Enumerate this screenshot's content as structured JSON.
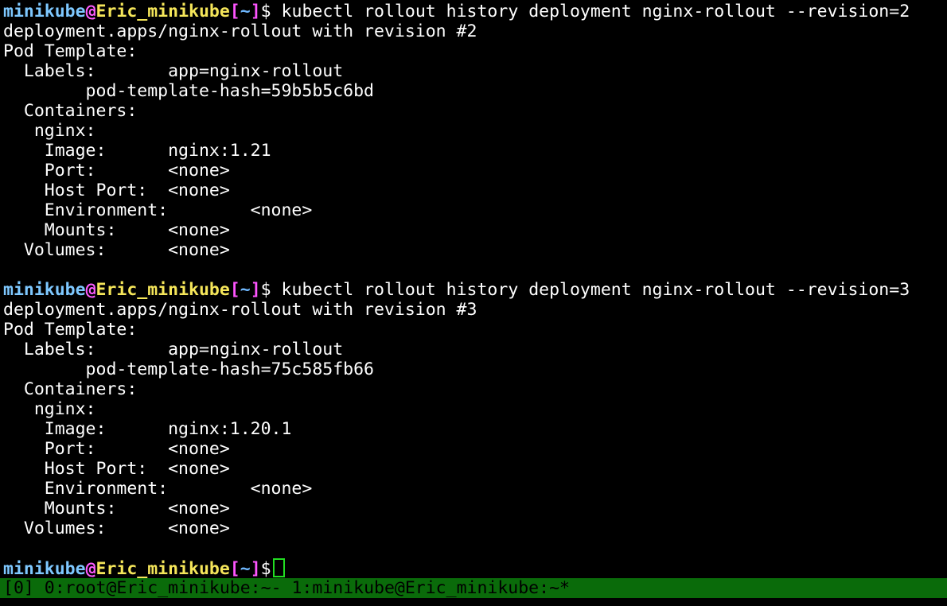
{
  "prompt": {
    "user": "minikube",
    "at": "@",
    "host": "Eric_minikube",
    "open_bracket": "[",
    "path": "~",
    "close_bracket": "]",
    "dollar": "$"
  },
  "blocks": [
    {
      "command": " kubectl rollout history deployment nginx-rollout --revision=2",
      "output": [
        "deployment.apps/nginx-rollout with revision #2",
        "Pod Template:",
        "  Labels:       app=nginx-rollout",
        "        pod-template-hash=59b5b5c6bd",
        "  Containers:",
        "   nginx:",
        "    Image:      nginx:1.21",
        "    Port:       <none>",
        "    Host Port:  <none>",
        "    Environment:        <none>",
        "    Mounts:     <none>",
        "  Volumes:      <none>",
        ""
      ]
    },
    {
      "command": " kubectl rollout history deployment nginx-rollout --revision=3",
      "output": [
        "deployment.apps/nginx-rollout with revision #3",
        "Pod Template:",
        "  Labels:       app=nginx-rollout",
        "        pod-template-hash=75c585fb66",
        "  Containers:",
        "   nginx:",
        "    Image:      nginx:1.20.1",
        "    Port:       <none>",
        "    Host Port:  <none>",
        "    Environment:        <none>",
        "    Mounts:     <none>",
        "  Volumes:      <none>",
        ""
      ]
    }
  ],
  "final_prompt_suffix": " ",
  "statusbar": {
    "session": "[0]",
    "window0": "0:root@Eric_minikube:~-",
    "window1": "1:minikube@Eric_minikube:~*"
  },
  "colors": {
    "user": "#7ec8ff",
    "at": "#ff5cff",
    "host": "#f5e65a",
    "bracket": "#ff55ff",
    "path": "#6fb8ff",
    "cursor": "#22dd22",
    "statusbar_bg": "#0a6b0a"
  }
}
